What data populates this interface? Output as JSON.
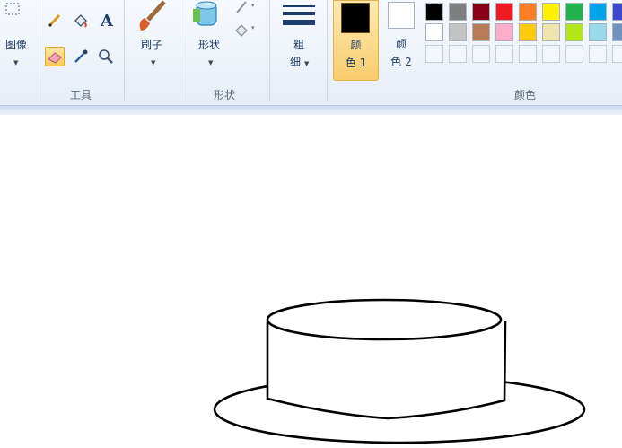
{
  "ribbon": {
    "image_group": {
      "image_label": "图像"
    },
    "tools_group": {
      "label": "工具",
      "text_tool_glyph": "A"
    },
    "brush": {
      "label": "刷子"
    },
    "shapes_group": {
      "label": "形状",
      "shapes_button_label": "形状"
    },
    "size": {
      "line1": "粗",
      "line2": "细"
    },
    "color1": {
      "line1": "颜",
      "line2": "色 1",
      "value": "#000000"
    },
    "color2": {
      "line1": "颜",
      "line2": "色 2",
      "value": "#ffffff"
    },
    "colors_group": {
      "label": "颜色"
    }
  },
  "palette": {
    "row1": [
      "#000000",
      "#7f7f7f",
      "#880015",
      "#ed1c24",
      "#ff7f27",
      "#fff200",
      "#22b14c",
      "#00a2e8",
      "#3f48cc"
    ],
    "row2": [
      "#ffffff",
      "#c3c3c3",
      "#b97a57",
      "#ffaec9",
      "#ffc90e",
      "#efe4b0",
      "#b5e61d",
      "#99d9ea",
      "#7092be"
    ]
  },
  "icons": {
    "image_select": "select-icon",
    "pencil": "pencil-icon",
    "fill": "fill-bucket-icon",
    "text": "text-icon",
    "eraser": "eraser-icon",
    "picker": "color-picker-icon",
    "magnifier": "magnifier-icon",
    "brush": "brush-icon",
    "shapes": "shapes-icon",
    "outline": "outline-icon",
    "fill_shape": "shape-fill-icon",
    "size": "line-size-icon"
  }
}
